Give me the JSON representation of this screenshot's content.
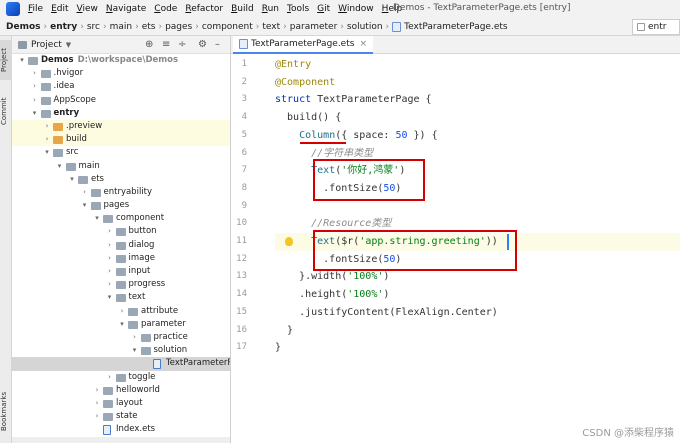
{
  "window": {
    "title": "Demos - TextParameterPage.ets [entry]"
  },
  "menu": [
    {
      "u": "F",
      "rest": "ile"
    },
    {
      "u": "E",
      "rest": "dit"
    },
    {
      "u": "V",
      "rest": "iew"
    },
    {
      "u": "N",
      "rest": "avigate"
    },
    {
      "u": "C",
      "rest": "ode"
    },
    {
      "u": "R",
      "rest": "efactor"
    },
    {
      "u": "B",
      "rest": "uild"
    },
    {
      "u": "R",
      "rest": "un"
    },
    {
      "u": "T",
      "rest": "ools"
    },
    {
      "u": "G",
      "rest": "it"
    },
    {
      "u": "W",
      "rest": "indow"
    },
    {
      "u": "H",
      "rest": "elp"
    }
  ],
  "breadcrumb": [
    "Demos",
    "entry",
    "src",
    "main",
    "ets",
    "pages",
    "component",
    "text",
    "parameter",
    "solution",
    "TextParameterPage.ets"
  ],
  "run_config": "entr",
  "left_stripe": {
    "project": "Project",
    "commit": "Commit",
    "bookmarks": "Bookmarks"
  },
  "project_panel": {
    "title": "Project",
    "tree": [
      {
        "depth": 0,
        "arrow": "open",
        "icon": "folder",
        "label": "Demos",
        "path": "D:\\workspace\\Demos",
        "bold": true
      },
      {
        "depth": 1,
        "arrow": "closed",
        "icon": "folder",
        "label": ".hvigor"
      },
      {
        "depth": 1,
        "arrow": "closed",
        "icon": "folder",
        "label": ".idea"
      },
      {
        "depth": 1,
        "arrow": "closed",
        "icon": "folder",
        "label": "AppScope"
      },
      {
        "depth": 1,
        "arrow": "open",
        "icon": "folder",
        "label": "entry",
        "bold": true
      },
      {
        "depth": 2,
        "arrow": "closed",
        "icon": "folder-orange",
        "label": ".preview",
        "hl": true
      },
      {
        "depth": 2,
        "arrow": "closed",
        "icon": "folder-orange",
        "label": "build",
        "hl": true
      },
      {
        "depth": 2,
        "arrow": "open",
        "icon": "folder",
        "label": "src"
      },
      {
        "depth": 3,
        "arrow": "open",
        "icon": "folder",
        "label": "main"
      },
      {
        "depth": 4,
        "arrow": "open",
        "icon": "folder",
        "label": "ets"
      },
      {
        "depth": 5,
        "arrow": "closed",
        "icon": "folder",
        "label": "entryability"
      },
      {
        "depth": 5,
        "arrow": "open",
        "icon": "folder",
        "label": "pages"
      },
      {
        "depth": 6,
        "arrow": "open",
        "icon": "folder",
        "label": "component"
      },
      {
        "depth": 7,
        "arrow": "closed",
        "icon": "folder",
        "label": "button"
      },
      {
        "depth": 7,
        "arrow": "closed",
        "icon": "folder",
        "label": "dialog"
      },
      {
        "depth": 7,
        "arrow": "closed",
        "icon": "folder",
        "label": "image"
      },
      {
        "depth": 7,
        "arrow": "closed",
        "icon": "folder",
        "label": "input"
      },
      {
        "depth": 7,
        "arrow": "closed",
        "icon": "folder",
        "label": "progress"
      },
      {
        "depth": 7,
        "arrow": "open",
        "icon": "folder",
        "label": "text"
      },
      {
        "depth": 8,
        "arrow": "closed",
        "icon": "folder",
        "label": "attribute"
      },
      {
        "depth": 8,
        "arrow": "open",
        "icon": "folder",
        "label": "parameter"
      },
      {
        "depth": 9,
        "arrow": "closed",
        "icon": "folder",
        "label": "practice"
      },
      {
        "depth": 9,
        "arrow": "open",
        "icon": "folder",
        "label": "solution"
      },
      {
        "depth": 10,
        "arrow": "none",
        "icon": "ets",
        "label": "TextParameterPage",
        "sel": true
      },
      {
        "depth": 7,
        "arrow": "closed",
        "icon": "folder",
        "label": "toggle"
      },
      {
        "depth": 6,
        "arrow": "closed",
        "icon": "folder",
        "label": "helloworld"
      },
      {
        "depth": 6,
        "arrow": "closed",
        "icon": "folder",
        "label": "layout"
      },
      {
        "depth": 6,
        "arrow": "closed",
        "icon": "folder",
        "label": "state"
      },
      {
        "depth": 6,
        "arrow": "none",
        "icon": "ets",
        "label": "Index.ets"
      }
    ]
  },
  "editor": {
    "tab_label": "TextParameterPage.ets",
    "line_numbers": [
      "1",
      "2",
      "3",
      "4",
      "5",
      "6",
      "7",
      "8",
      "9",
      "10",
      "11",
      "12",
      "13",
      "14",
      "15",
      "16",
      "17"
    ],
    "lines": [
      [
        {
          "t": "@Entry",
          "c": "an"
        }
      ],
      [
        {
          "t": "@Component",
          "c": "an"
        }
      ],
      [
        {
          "t": "struct ",
          "c": "kw"
        },
        {
          "t": "TextParameterPage {",
          "c": "pl"
        }
      ],
      [
        {
          "t": "  build() {",
          "c": "pl"
        }
      ],
      [
        {
          "t": "    ",
          "c": "pl"
        },
        {
          "t": "Column",
          "c": "ty"
        },
        {
          "t": "({ space: ",
          "c": "pl"
        },
        {
          "t": "50",
          "c": "num"
        },
        {
          "t": " }) {",
          "c": "pl"
        }
      ],
      [
        {
          "t": "      //字符串类型",
          "c": "cm"
        }
      ],
      [
        {
          "t": "      ",
          "c": "pl"
        },
        {
          "t": "Text",
          "c": "ty"
        },
        {
          "t": "(",
          "c": "pl"
        },
        {
          "t": "'你好,鸿蒙'",
          "c": "str"
        },
        {
          "t": ")",
          "c": "pl"
        }
      ],
      [
        {
          "t": "        .fontSize(",
          "c": "pl"
        },
        {
          "t": "50",
          "c": "num"
        },
        {
          "t": ")",
          "c": "pl"
        }
      ],
      [
        {
          "t": "",
          "c": "pl"
        }
      ],
      [
        {
          "t": "      //Resource类型",
          "c": "cm"
        }
      ],
      [
        {
          "t": "      ",
          "c": "pl"
        },
        {
          "t": "Text",
          "c": "ty"
        },
        {
          "t": "($r(",
          "c": "pl"
        },
        {
          "t": "'app.string.greeting'",
          "c": "str"
        },
        {
          "t": "))",
          "c": "pl"
        }
      ],
      [
        {
          "t": "        .fontSize(",
          "c": "pl"
        },
        {
          "t": "50",
          "c": "num"
        },
        {
          "t": ")",
          "c": "pl"
        }
      ],
      [
        {
          "t": "    }.width(",
          "c": "pl"
        },
        {
          "t": "'100%'",
          "c": "str"
        },
        {
          "t": ")",
          "c": "pl"
        }
      ],
      [
        {
          "t": "    .height(",
          "c": "pl"
        },
        {
          "t": "'100%'",
          "c": "str"
        },
        {
          "t": ")",
          "c": "pl"
        }
      ],
      [
        {
          "t": "    .justifyContent(FlexAlign.Center)",
          "c": "pl"
        }
      ],
      [
        {
          "t": "  }",
          "c": "pl"
        }
      ],
      [
        {
          "t": "}",
          "c": "pl"
        }
      ]
    ],
    "current_line": 11
  },
  "watermark": "CSDN @添柴程序猿"
}
